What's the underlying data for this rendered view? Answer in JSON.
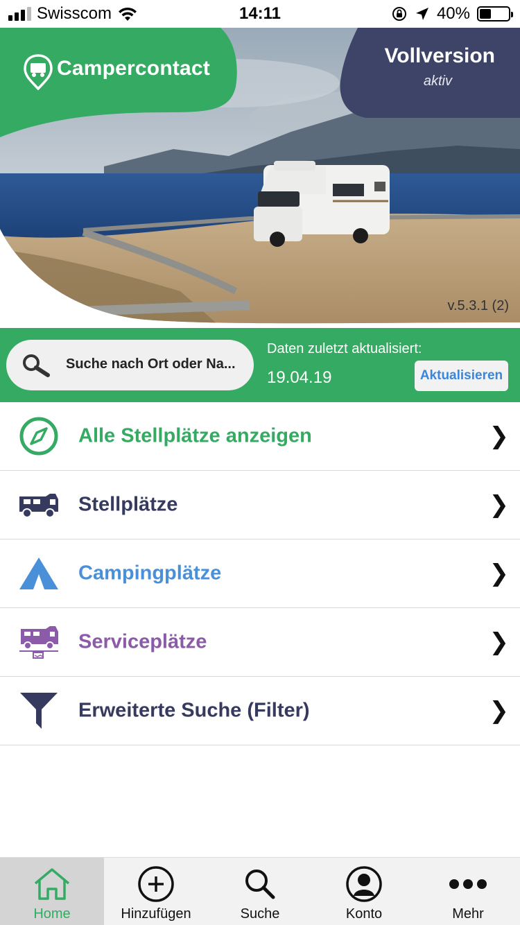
{
  "status_bar": {
    "carrier": "Swisscom",
    "time": "14:11",
    "battery_percent": "40%",
    "battery_level": 0.4,
    "signal_bars_filled": 3,
    "icons": [
      "signal-icon",
      "wifi-icon",
      "orientation-lock-icon",
      "location-arrow-icon",
      "battery-icon"
    ]
  },
  "hero": {
    "logo_text": "Campercontact",
    "version_title": "Vollversion",
    "version_subtitle": "aktiv",
    "version_label": "v.5.3.1 (2)",
    "brand_green": "#35aa63",
    "badge_navy": "#3e4467"
  },
  "search": {
    "placeholder": "Suche nach Ort oder Na...",
    "updated_label": "Daten zuletzt aktualisiert:",
    "updated_date": "19.04.19",
    "update_button": "Aktualisieren"
  },
  "menu": {
    "items": [
      {
        "label": "Alle Stellplätze anzeigen",
        "icon": "compass-icon",
        "color": "#35aa63"
      },
      {
        "label": "Stellplätze",
        "icon": "camper-icon",
        "color": "#363a5e"
      },
      {
        "label": "Campingplätze",
        "icon": "tent-icon",
        "color": "#4a90d9"
      },
      {
        "label": "Serviceplätze",
        "icon": "service-camper-icon",
        "color": "#8b5aa8"
      },
      {
        "label": "Erweiterte Suche (Filter)",
        "icon": "filter-icon",
        "color": "#363a5e"
      }
    ],
    "chevron": "❯"
  },
  "tabbar": {
    "tabs": [
      {
        "label": "Home",
        "icon": "home-icon",
        "active": true
      },
      {
        "label": "Hinzufügen",
        "icon": "add-circle-icon",
        "active": false
      },
      {
        "label": "Suche",
        "icon": "search-icon",
        "active": false
      },
      {
        "label": "Konto",
        "icon": "account-icon",
        "active": false
      },
      {
        "label": "Mehr",
        "icon": "more-icon",
        "active": false
      }
    ]
  }
}
